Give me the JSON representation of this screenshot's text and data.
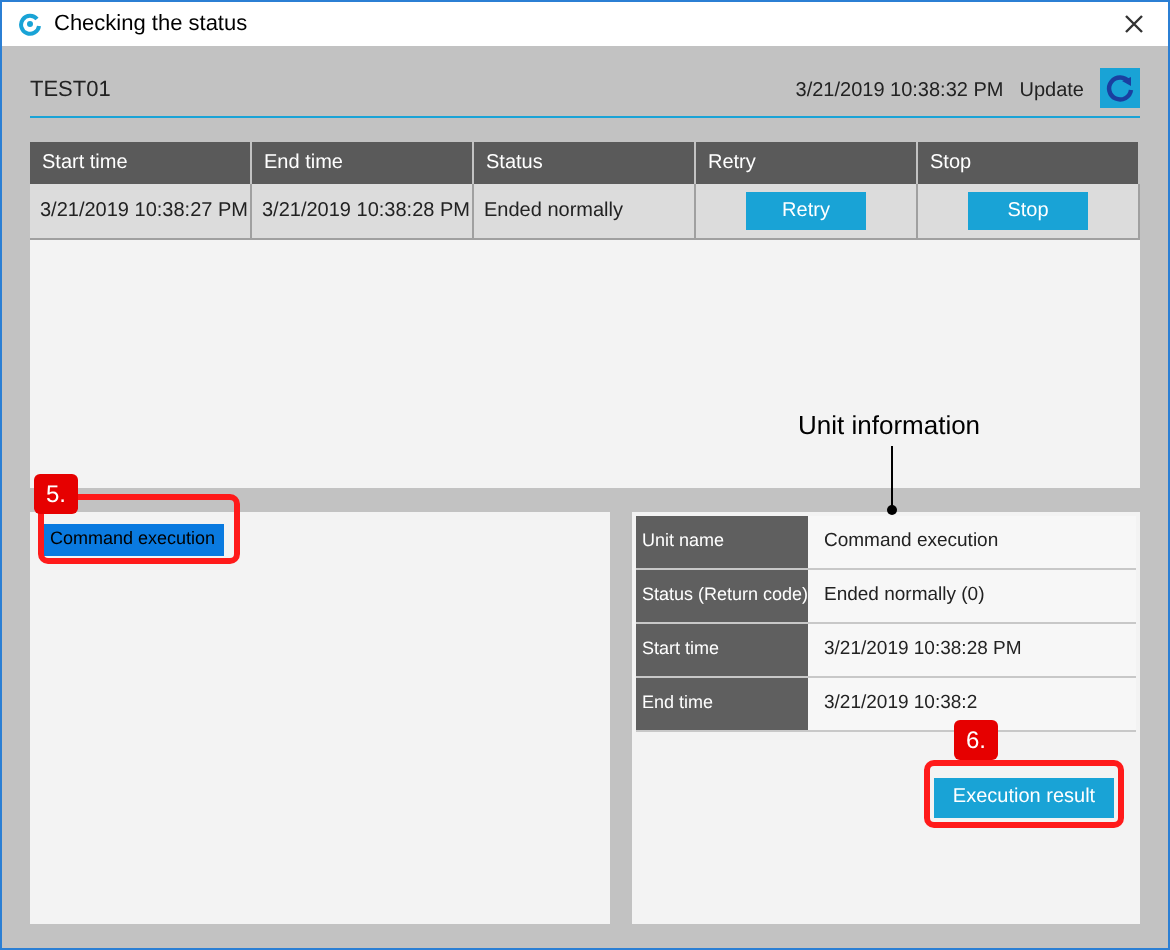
{
  "window": {
    "title": "Checking the status"
  },
  "header": {
    "name": "TEST01",
    "timestamp": "3/21/2019 10:38:32 PM",
    "update_label": "Update"
  },
  "table": {
    "columns": [
      "Start time",
      "End time",
      "Status",
      "Retry",
      "Stop"
    ],
    "rows": [
      {
        "start_time": "3/21/2019 10:38:27 PM",
        "end_time": "3/21/2019 10:38:28 PM",
        "status": "Ended normally",
        "retry_button": "Retry",
        "stop_button": "Stop"
      }
    ]
  },
  "units": [
    {
      "label": "Command execution",
      "selected": true
    }
  ],
  "unit_info": {
    "rows": [
      {
        "label": "Unit name",
        "value": "Command execution"
      },
      {
        "label": "Status (Return code)",
        "value": "Ended normally (0)"
      },
      {
        "label": "Start time",
        "value": "3/21/2019 10:38:28 PM"
      },
      {
        "label": "End time",
        "value": "3/21/2019 10:38:2"
      }
    ],
    "button": "Execution result"
  },
  "annotations": [
    {
      "kind": "callout",
      "text": "Unit information"
    },
    {
      "kind": "step",
      "text": "5."
    },
    {
      "kind": "step",
      "text": "6."
    }
  ]
}
